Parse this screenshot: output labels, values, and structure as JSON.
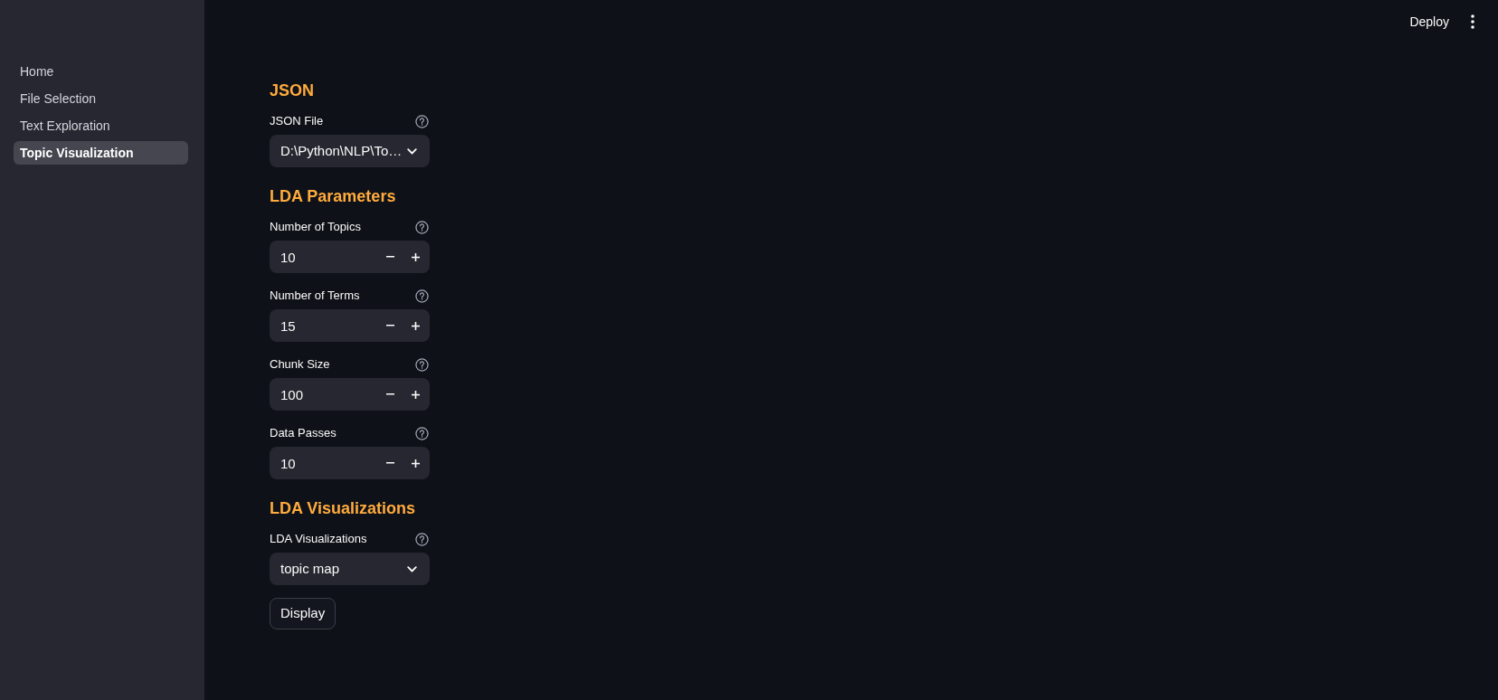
{
  "sidebar": {
    "items": [
      {
        "label": "Home",
        "selected": false
      },
      {
        "label": "File Selection",
        "selected": false
      },
      {
        "label": "Text Exploration",
        "selected": false
      },
      {
        "label": "Topic Visualization",
        "selected": true
      }
    ]
  },
  "header": {
    "deploy": "Deploy"
  },
  "sections": [
    {
      "heading": "JSON",
      "fields": [
        {
          "kind": "select",
          "label": "JSON File",
          "value": "D:\\Python\\NLP\\To…"
        }
      ]
    },
    {
      "heading": "LDA Parameters",
      "fields": [
        {
          "kind": "number",
          "label": "Number of Topics",
          "value": "10"
        },
        {
          "kind": "number",
          "label": "Number of Terms",
          "value": "15"
        },
        {
          "kind": "number",
          "label": "Chunk Size",
          "value": "100"
        },
        {
          "kind": "number",
          "label": "Data Passes",
          "value": "10"
        }
      ]
    },
    {
      "heading": "LDA Visualizations",
      "fields": [
        {
          "kind": "select",
          "label": "LDA Visualizations",
          "value": "topic map"
        }
      ]
    }
  ],
  "display_button": "Display"
}
